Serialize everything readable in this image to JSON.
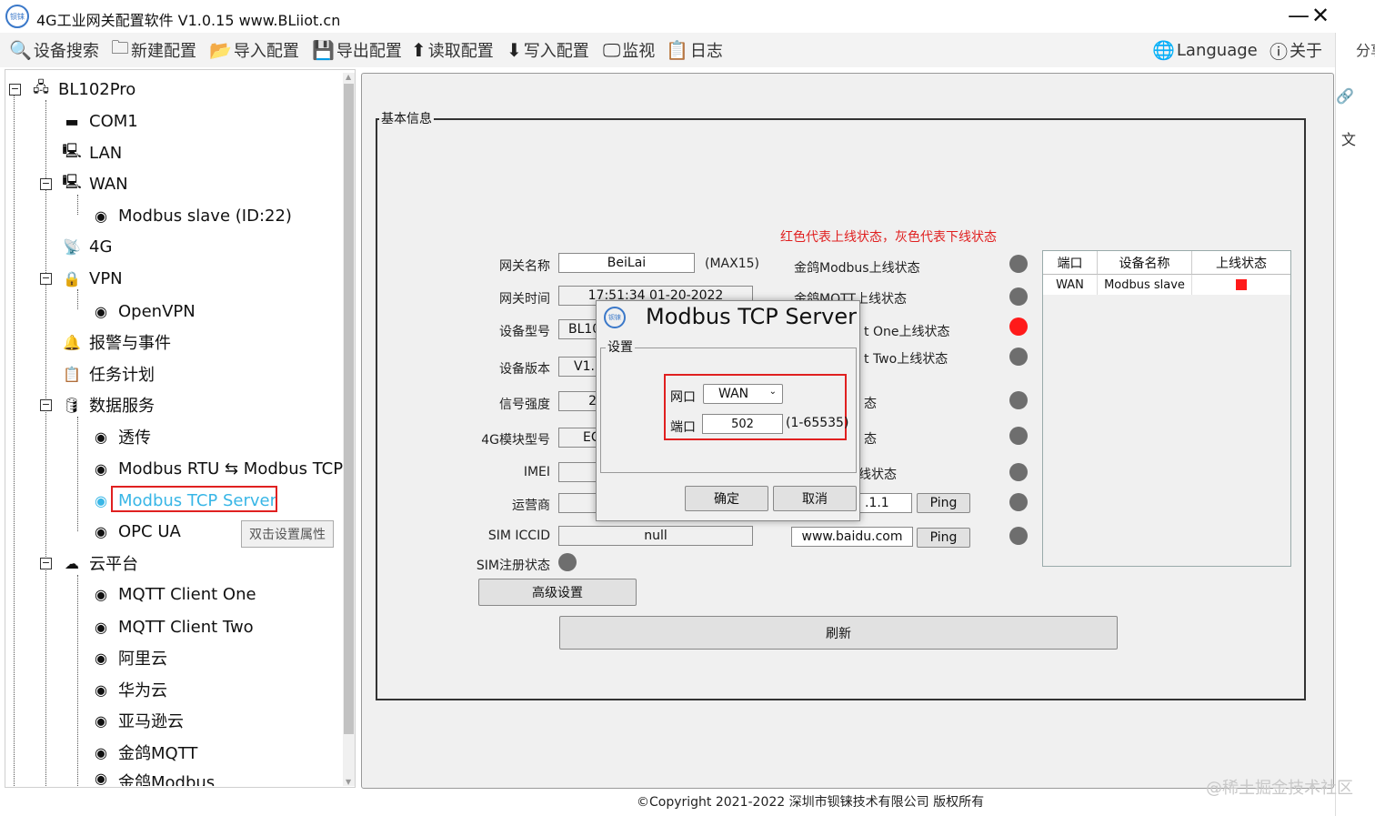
{
  "app": {
    "title": "4G工业网关配置软件 V1.0.15 www.BLiiot.cn",
    "logo_text": "钡铼"
  },
  "window_controls": {
    "minimize": "—",
    "close": "✕"
  },
  "toolbar": {
    "search": "设备搜索",
    "new_config": "新建配置",
    "import_config": "导入配置",
    "export_config": "导出配置",
    "read_config": "读取配置",
    "write_config": "写入配置",
    "monitor": "监视",
    "log": "日志",
    "language": "Language",
    "about": "关于",
    "share": "分享"
  },
  "tree": {
    "root": "BL102Pro",
    "com1": "COM1",
    "lan": "LAN",
    "wan": "WAN",
    "modbus_slave": "Modbus slave  (ID:22)",
    "g4": "4G",
    "vpn": "VPN",
    "openvpn": "OpenVPN",
    "alarm": "报警与事件",
    "task": "任务计划",
    "data_service": "数据服务",
    "passthrough": "透传",
    "rtu_tcp": "Modbus RTU ⇆ Modbus TCP",
    "tcp_server": "Modbus TCP Server",
    "opcua": "OPC UA",
    "cloud": "云平台",
    "mqtt1": "MQTT Client One",
    "mqtt2": "MQTT Client Two",
    "aliyun": "阿里云",
    "huawei": "华为云",
    "aws": "亚马逊云",
    "jingemqtt": "金鸽MQTT",
    "jingemodbus": "金鸽Modbus",
    "tooltip": "双击设置属性"
  },
  "basic_info": {
    "group_title": "基本信息",
    "status_note": "红色代表上线状态，灰色代表下线状态",
    "gateway_name_label": "网关名称",
    "gateway_name_value": "BeiLai",
    "gateway_name_hint": "(MAX15)",
    "gateway_time_label": "网关时间",
    "gateway_time_value": "17:51:34 01-20-2022",
    "device_model_label": "设备型号",
    "device_model_value": "BL10",
    "device_version_label": "设备版本",
    "device_version_value": "V1.",
    "signal_label": "信号强度",
    "signal_value": "2",
    "module_label": "4G模块型号",
    "module_value": "EC",
    "imei_label": "IMEI",
    "imei_value": "",
    "operator_label": "运营商",
    "operator_value": "",
    "iccid_label": "SIM ICCID",
    "iccid_value": "null",
    "sim_reg_label": "SIM注册状态",
    "advanced_button": "高级设置",
    "refresh_button": "刷新",
    "status1": "金鸽Modbus上线状态",
    "status2": "金鸽MQTT上线状态",
    "status3": "t One上线状态",
    "status4": "t Two上线状态",
    "status5": "态",
    "status6": "态",
    "status7": "线状态",
    "ping_ip": ".1.1",
    "ping_domain": "www.baidu.com",
    "ping_label": "Ping"
  },
  "port_table": {
    "headers": [
      "端口",
      "设备名称",
      "上线状态"
    ],
    "rows": [
      [
        "WAN",
        "Modbus slave",
        "online"
      ]
    ]
  },
  "dialog": {
    "title": "Modbus TCP Server",
    "logo_text": "钡铼",
    "group_title": "设置",
    "port_label": "网口",
    "port_value": "WAN",
    "num_label": "端口",
    "num_value": "502",
    "num_range": "(1-65535)",
    "ok": "确定",
    "cancel": "取消"
  },
  "footer": {
    "copyright": "©Copyright 2021-2022 深圳市钡铼技术有限公司 版权所有",
    "watermark": "@稀土掘金技术社区"
  },
  "colors": {
    "online": "#ff1a1a",
    "offline": "#6e6e6e",
    "selected": "#38b6e6",
    "highlight": "#e02020"
  }
}
